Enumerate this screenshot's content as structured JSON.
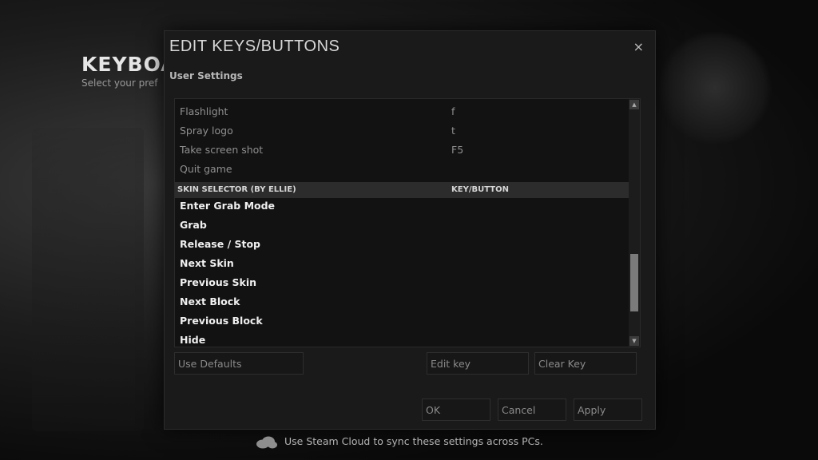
{
  "background": {
    "title": "KEYBOA",
    "subtitle": "Select your pref"
  },
  "dialog": {
    "title": "EDIT KEYS/BUTTONS",
    "close_label": "×",
    "section_label": "User Settings"
  },
  "list": {
    "rows_before": [
      {
        "action": "Flashlight",
        "key": "f"
      },
      {
        "action": "Spray logo",
        "key": "t"
      },
      {
        "action": "Take screen shot",
        "key": "F5"
      },
      {
        "action": "Quit game",
        "key": ""
      }
    ],
    "header": {
      "col1": "SKIN SELECTOR (BY ELLIE)",
      "col2": "KEY/BUTTON"
    },
    "rows_after": [
      {
        "action": "Enter Grab Mode",
        "key": ""
      },
      {
        "action": "Grab",
        "key": ""
      },
      {
        "action": "Release / Stop",
        "key": ""
      },
      {
        "action": "Next Skin",
        "key": ""
      },
      {
        "action": "Previous Skin",
        "key": ""
      },
      {
        "action": "Next Block",
        "key": ""
      },
      {
        "action": "Previous Block",
        "key": ""
      },
      {
        "action": "Hide",
        "key": ""
      }
    ],
    "scroll_up": "▲",
    "scroll_down": "▼"
  },
  "buttons": {
    "use_defaults": "Use Defaults",
    "edit_key": "Edit key",
    "clear_key": "Clear Key",
    "ok": "OK",
    "cancel": "Cancel",
    "apply": "Apply"
  },
  "footer": {
    "cloud_icon": "cloud-icon",
    "text": "Use Steam Cloud to sync these settings across PCs."
  }
}
